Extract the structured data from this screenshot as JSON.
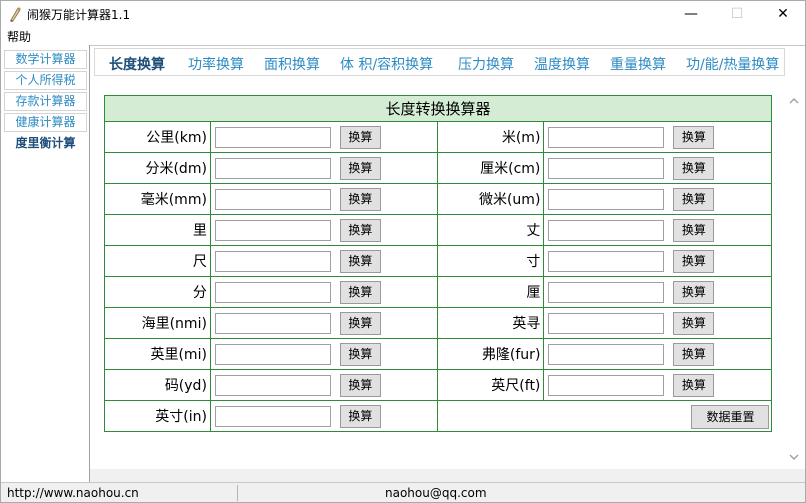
{
  "window": {
    "title": "闹猴万能计算器1.1",
    "minimize": "—",
    "maximize": "☐",
    "close": "✕"
  },
  "menu": {
    "help": "帮助"
  },
  "sidebar": {
    "items": [
      {
        "label": "数学计算器"
      },
      {
        "label": "个人所得税"
      },
      {
        "label": "存款计算器"
      },
      {
        "label": "健康计算器"
      },
      {
        "label": "度里衡计算"
      }
    ],
    "active_index": 4
  },
  "tabs": [
    {
      "label": "长度换算"
    },
    {
      "label": "功率换算"
    },
    {
      "label": "面积换算"
    },
    {
      "label": "体 积/容积换算"
    },
    {
      "label": "压力换算"
    },
    {
      "label": "温度换算"
    },
    {
      "label": "重量换算"
    },
    {
      "label": "功/能/热量换算"
    }
  ],
  "converter": {
    "title": "长度转换换算器",
    "convert_label": "换算",
    "reset_label": "数据重置",
    "rows": [
      {
        "left": {
          "unit": "公里(km)",
          "value": ""
        },
        "right": {
          "unit": "米(m)",
          "value": ""
        }
      },
      {
        "left": {
          "unit": "分米(dm)",
          "value": ""
        },
        "right": {
          "unit": "厘米(cm)",
          "value": ""
        }
      },
      {
        "left": {
          "unit": "毫米(mm)",
          "value": ""
        },
        "right": {
          "unit": "微米(um)",
          "value": ""
        }
      },
      {
        "left": {
          "unit": "里",
          "value": ""
        },
        "right": {
          "unit": "丈",
          "value": ""
        }
      },
      {
        "left": {
          "unit": "尺",
          "value": ""
        },
        "right": {
          "unit": "寸",
          "value": ""
        }
      },
      {
        "left": {
          "unit": "分",
          "value": ""
        },
        "right": {
          "unit": "厘",
          "value": ""
        }
      },
      {
        "left": {
          "unit": "海里(nmi)",
          "value": ""
        },
        "right": {
          "unit": "英寻",
          "value": ""
        }
      },
      {
        "left": {
          "unit": "英里(mi)",
          "value": ""
        },
        "right": {
          "unit": "弗隆(fur)",
          "value": ""
        }
      },
      {
        "left": {
          "unit": "码(yd)",
          "value": ""
        },
        "right": {
          "unit": "英尺(ft)",
          "value": ""
        }
      },
      {
        "left": {
          "unit": "英寸(in)",
          "value": ""
        }
      }
    ]
  },
  "status": {
    "website": "http://www.naohou.cn",
    "email": "naohou@qq.com"
  }
}
